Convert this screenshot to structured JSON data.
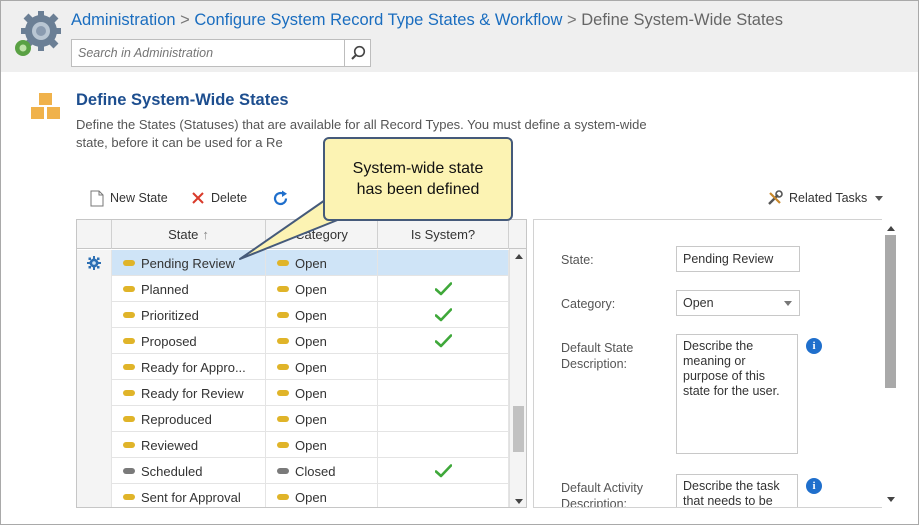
{
  "header": {
    "breadcrumb": [
      {
        "label": "Administration",
        "link": true
      },
      {
        "label": "Configure System Record Type States & Workflow",
        "link": true
      },
      {
        "label": "Define System-Wide States",
        "link": false
      }
    ],
    "search_placeholder": "Search in Administration",
    "separator": ">"
  },
  "page": {
    "title": "Define System-Wide States",
    "description": "Define the States (Statuses) that are available for all Record Types. You must define a system-wide state, before it can be used for a Re"
  },
  "toolbar": {
    "new_state": "New State",
    "delete": "Delete",
    "related_tasks": "Related Tasks"
  },
  "grid": {
    "columns": {
      "state": "State",
      "category": "Category",
      "is_system": "Is System?"
    },
    "sort_indicator": "↑",
    "rows": [
      {
        "state": "Pending Review",
        "category": "Open",
        "system": false,
        "selected": true
      },
      {
        "state": "Planned",
        "category": "Open",
        "system": true,
        "selected": false
      },
      {
        "state": "Prioritized",
        "category": "Open",
        "system": true,
        "selected": false
      },
      {
        "state": "Proposed",
        "category": "Open",
        "system": true,
        "selected": false
      },
      {
        "state": "Ready for Appro...",
        "category": "Open",
        "system": false,
        "selected": false
      },
      {
        "state": "Ready for Review",
        "category": "Open",
        "system": false,
        "selected": false
      },
      {
        "state": "Reproduced",
        "category": "Open",
        "system": false,
        "selected": false
      },
      {
        "state": "Reviewed",
        "category": "Open",
        "system": false,
        "selected": false
      },
      {
        "state": "Scheduled",
        "category": "Closed",
        "system": true,
        "selected": false
      },
      {
        "state": "Sent for Approval",
        "category": "Open",
        "system": false,
        "selected": false
      }
    ]
  },
  "callout": {
    "line1": "System-wide state",
    "line2": "has been defined"
  },
  "details": {
    "state_label": "State:",
    "state_value": "Pending Review",
    "category_label": "Category:",
    "category_value": "Open",
    "default_state_desc_label": "Default State Description:",
    "default_state_desc_value": "Describe the meaning or purpose of this state for the user.",
    "default_activity_desc_label": "Default Activity Description:",
    "default_activity_desc_value": "Describe the task that needs to be"
  },
  "colors": {
    "link": "#1a6dbf",
    "title": "#1d4e8f",
    "open_pill": "#e0b429",
    "closed_pill": "#7a7a7a",
    "check": "#3fa83a",
    "selected_row": "#cfe4f7",
    "callout_bg": "#fcf3b3"
  },
  "icons": {
    "logo": "gears-icon",
    "search": "search-icon",
    "page": "boxes-icon",
    "new": "document-icon",
    "delete": "x-icon",
    "refresh": "refresh-icon",
    "related": "tools-icon",
    "row_settings": "gear-icon",
    "checkmark": "check-icon",
    "info": "info-icon"
  }
}
